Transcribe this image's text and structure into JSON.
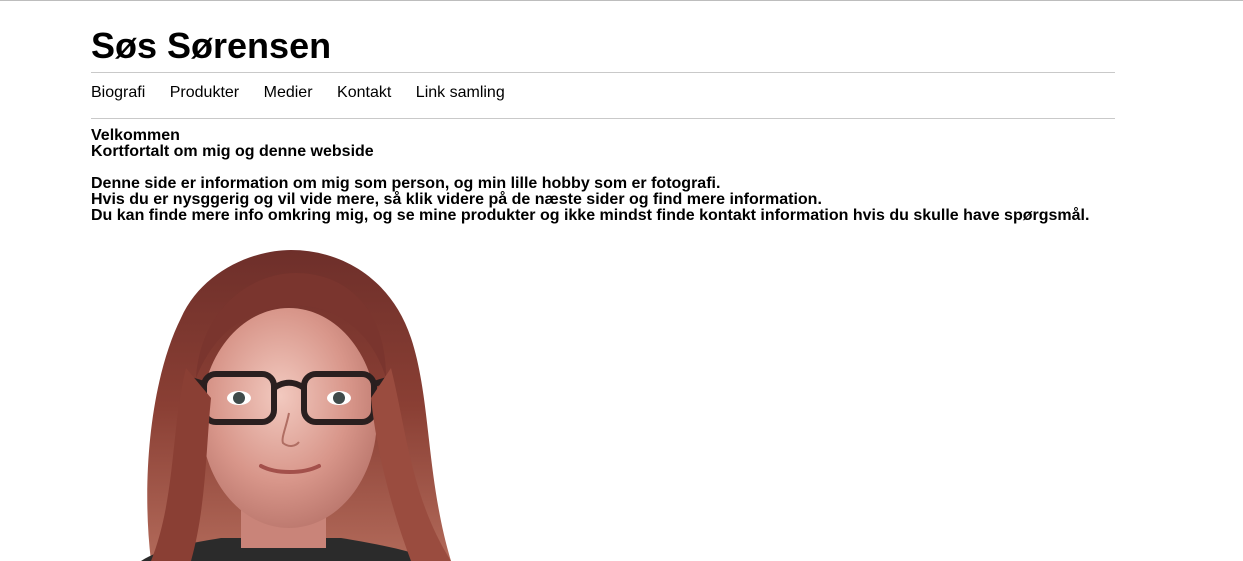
{
  "site": {
    "title": "Søs Sørensen"
  },
  "nav": {
    "items": [
      {
        "label": "Biografi"
      },
      {
        "label": "Produkter"
      },
      {
        "label": "Medier"
      },
      {
        "label": "Kontakt"
      },
      {
        "label": "Link samling"
      }
    ]
  },
  "content": {
    "heading": "Velkommen",
    "subheading": "Kortfortalt om mig og denne webside",
    "paragraphs": [
      "Denne side er information om mig som person, og min lille hobby som er fotografi.",
      "Hvis du er nysggerig og vil vide mere, så klik videre på de næste sider og find mere information.",
      "Du kan finde mere info omkring mig, og se mine produkter og ikke mindst finde kontakt information hvis du skulle have spørgsmål."
    ]
  },
  "colors": {
    "hair": "#8a3f34",
    "skin": "#d8968a",
    "glasses": "#2a1f1f",
    "rule": "#c9c9c9"
  }
}
